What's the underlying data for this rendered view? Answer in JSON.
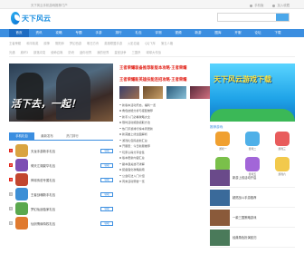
{
  "topbar": {
    "notice": "天下风云手机游戏推荐门户",
    "links": [
      "手机版",
      "加入收藏"
    ]
  },
  "logo": {
    "text": "天下风云"
  },
  "nav": {
    "items": [
      "首页",
      "资讯",
      "攻略",
      "专题",
      "手游",
      "排行",
      "礼包",
      "评测",
      "视频",
      "新游",
      "图库",
      "开服",
      "论坛",
      "下载"
    ]
  },
  "subnav": {
    "row1": [
      "王者荣耀",
      "和平精英",
      "原神",
      "阴阳师",
      "梦幻西游",
      "明日方舟",
      "英雄联盟手游",
      "火影忍者",
      "QQ飞车",
      "第五人格"
    ],
    "row2": [
      "光遇",
      "崩坏3",
      "部落冲突",
      "使命召唤",
      "奶块",
      "迷你世界",
      "我的世界",
      "皇室战争",
      "三国杀",
      "球球大作战"
    ]
  },
  "hero": {
    "caption": "活下去，一起！"
  },
  "headlines": [
    "王者荣耀装备推荐新版本攻略·王者荣耀",
    "王者荣耀新英雄技能连招攻略·王者荣耀"
  ],
  "news": [
    "新版本活动开启，福利一览",
    "角色技能分析与搭配推荐",
    "新手入门必看攻略大全",
    "限时活动奖励领取方法",
    "热门手游排行榜本周更新",
    "新英雄上线全面解析",
    "游戏礼包码最新汇总",
    "开服表：今日新服推荐",
    "玩家心得分享合集",
    "版本更新内容汇总",
    "副本通关技巧详解",
    "装备强化攻略指南",
    "公会玩法入门介绍",
    "周末活动预告一览"
  ],
  "tabs": [
    "手机礼包",
    "最新发布",
    "热门排行"
  ],
  "rank": [
    {
      "name": "天龙手游新手礼包",
      "btn": "领取"
    },
    {
      "name": "倚天江湖豪华礼包",
      "btn": "领取"
    },
    {
      "name": "神将传说专属礼包",
      "btn": "领取"
    },
    {
      "name": "王者战魂新手礼包",
      "btn": "领取"
    },
    {
      "name": "梦幻仙途独家礼包",
      "btn": "领取"
    },
    {
      "name": "仙剑情缘特权礼包",
      "btn": "领取"
    }
  ],
  "banner": {
    "text": "天下风云游戏下载"
  },
  "sidegrid": {
    "title": "推荐游戏",
    "items": [
      "游戏一",
      "游戏二",
      "游戏三",
      "游戏四",
      "游戏五",
      "游戏六"
    ]
  },
  "sidelist": [
    "新游上线活动开启",
    "超燃战斗手游推荐",
    "一款三国策略游戏",
    "经典角色扮演回归"
  ]
}
